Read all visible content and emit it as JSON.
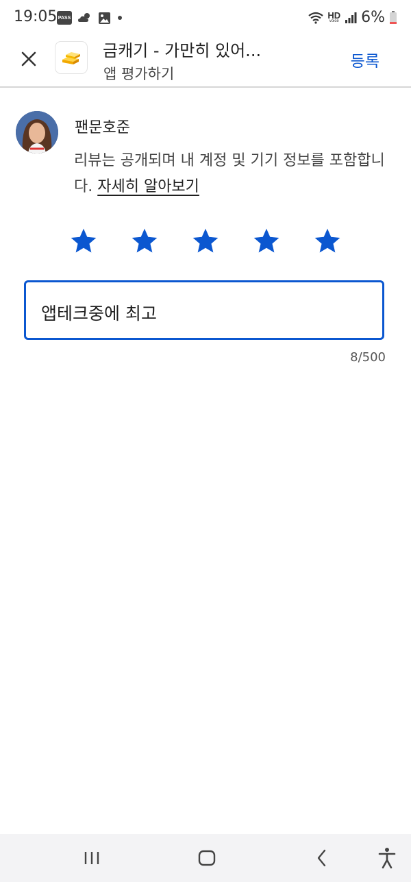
{
  "status_bar": {
    "time": "19:05",
    "pass_label": "PASS",
    "hd_label": "HD",
    "voice_label": "voice",
    "battery": "6%"
  },
  "header": {
    "title": "금캐기 - 가만히 있어...",
    "subtitle": "앱 평가하기",
    "submit_label": "등록"
  },
  "review": {
    "reviewer_name": "팬문호준",
    "disclosure_text": "리뷰는 공개되며 내 계정 및 기기 정보를 포함합니다.",
    "learn_more_label": "자세히 알아보기",
    "rating": 5,
    "text": "앱테크중에 최고",
    "char_count": "8/500"
  },
  "colors": {
    "accent": "#0b57d0",
    "text": "#1f1f1f",
    "nav_bg": "#f3f3f5"
  },
  "icons": [
    "close-icon",
    "gold-bars-icon",
    "star-icon",
    "recent-apps-icon",
    "home-icon",
    "back-icon",
    "accessibility-icon"
  ]
}
